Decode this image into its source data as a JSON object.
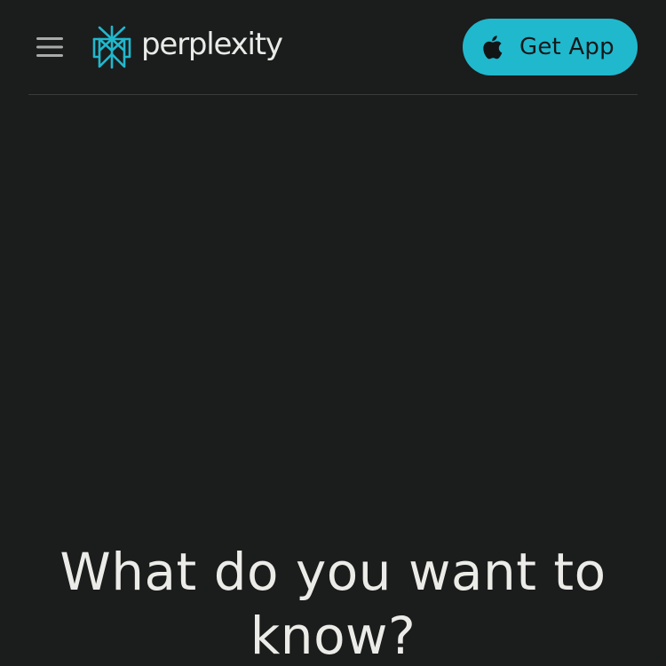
{
  "header": {
    "menu_icon": "hamburger-menu-icon",
    "brand": {
      "logo_icon": "perplexity-logo-icon",
      "name": "perplexity"
    },
    "get_app": {
      "icon": "apple-icon",
      "label": "Get App"
    }
  },
  "hero": {
    "title": "What do you want to know?"
  },
  "colors": {
    "background": "#1b1c1c",
    "accent": "#20b8cd",
    "text": "#ebebe8",
    "divider": "#3a3c3c"
  }
}
